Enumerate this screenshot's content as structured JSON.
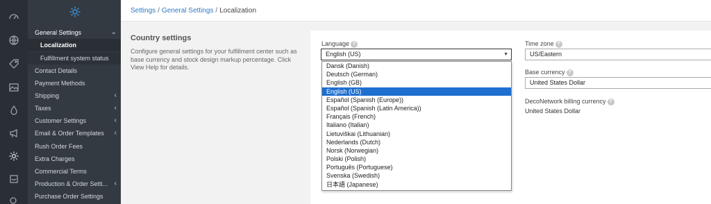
{
  "breadcrumb": {
    "items": [
      "Settings",
      "General Settings"
    ],
    "current": "Localization"
  },
  "sidebar": {
    "items": [
      {
        "label": "General Settings"
      },
      {
        "label": "Localization"
      },
      {
        "label": "Fulfillment system status"
      },
      {
        "label": "Contact Details"
      },
      {
        "label": "Payment Methods"
      },
      {
        "label": "Shipping"
      },
      {
        "label": "Taxes"
      },
      {
        "label": "Customer Settings"
      },
      {
        "label": "Email & Order Templates"
      },
      {
        "label": "Rush Order Fees"
      },
      {
        "label": "Extra Charges"
      },
      {
        "label": "Commercial Terms"
      },
      {
        "label": "Production & Order Setti..."
      },
      {
        "label": "Purchase Order Settings"
      }
    ]
  },
  "section": {
    "title": "Country settings",
    "description": "Configure general settings for your fulfillment center such as base currency and stock design markup percentage. Click View Help for details."
  },
  "language": {
    "label": "Language",
    "value": "English (US)",
    "options": [
      "Dansk (Danish)",
      "Deutsch (German)",
      "English (GB)",
      "English (US)",
      "Español (Spanish (Europe))",
      "Español (Spanish (Latin America))",
      "Français (French)",
      "Italiano (Italian)",
      "Lietuviškai (Lithuanian)",
      "Nederlands (Dutch)",
      "Norsk (Norwegian)",
      "Polski (Polish)",
      "Português (Portuguese)",
      "Svenska (Swedish)",
      "日本語 (Japanese)"
    ],
    "selected_index": 3
  },
  "timezone": {
    "label": "Time zone",
    "value": "US/Eastern"
  },
  "base_currency": {
    "label": "Base currency",
    "value": "United States Dollar"
  },
  "billing_currency": {
    "label": "DecoNetwork billing currency",
    "value": "United States Dollar"
  },
  "help_glyph": "?",
  "colors": {
    "accent": "#2b7bc4",
    "selected": "#1e6fcf",
    "sidebar_bg": "#343a42",
    "iconbar_bg": "#2a2f36"
  }
}
